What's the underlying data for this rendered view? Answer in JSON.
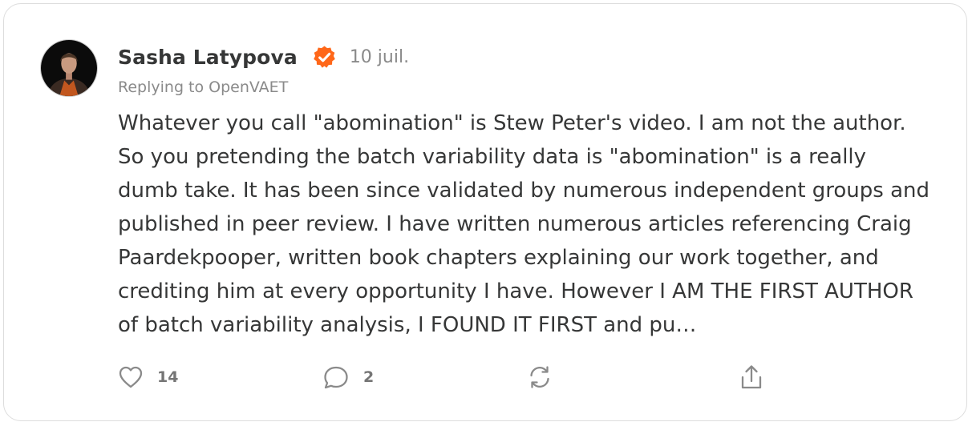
{
  "note": {
    "author": "Sasha Latypova",
    "verified_icon": "verified-check-icon",
    "date": "10 juil.",
    "replying_to": "Replying to OpenVAET",
    "body": "Whatever you call \"abomination\" is Stew Peter's video. I am not the author.\nSo you pretending the batch variability data is \"abomination\" is a really\ndumb take. It has been since validated by numerous independent groups and\npublished in peer review. I have written numerous articles referencing Craig\nPaardekpooper, written book chapters explaining our work together, and\ncrediting him at every opportunity I have. However I AM THE FIRST AUTHOR\nof batch variability analysis, I FOUND IT FIRST and pu…"
  },
  "actions": {
    "like_count": "14",
    "comment_count": "2",
    "like_icon": "heart-icon",
    "comment_icon": "comment-bubble-icon",
    "restack_icon": "restack-icon",
    "share_icon": "share-icon"
  },
  "colors": {
    "accent": "#FF6719",
    "text": "#363737",
    "muted": "#8A8A8A",
    "border": "#DDDDDD"
  }
}
